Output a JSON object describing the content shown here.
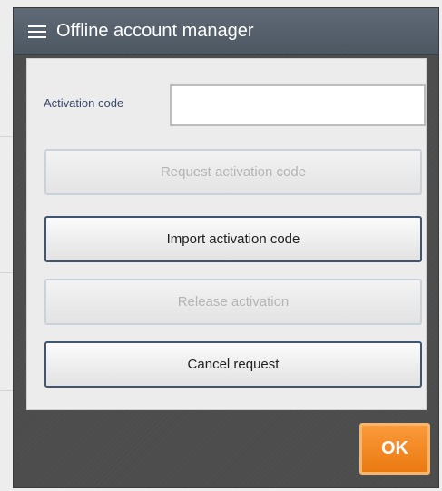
{
  "dialog": {
    "title": "Offline account manager",
    "menu_icon": "hamburger-menu-icon"
  },
  "form": {
    "activation_code_label": "Activation code",
    "activation_code_value": "",
    "activation_code_placeholder": ""
  },
  "buttons": {
    "request_activation_code": {
      "label": "Request  activation code",
      "enabled": false
    },
    "import_activation_code": {
      "label": "Import activation code",
      "enabled": true
    },
    "release_activation": {
      "label": "Release activation",
      "enabled": false
    },
    "cancel_request": {
      "label": "Cancel request",
      "enabled": true
    },
    "ok": {
      "label": "OK"
    }
  },
  "colors": {
    "title_bar": "#56606b",
    "dialog_body": "#4c4c4c",
    "panel": "#ececec",
    "ok_accent": "#f28a1e",
    "enabled_button_border": "#3f5570",
    "disabled_text": "#b4b4b4"
  }
}
